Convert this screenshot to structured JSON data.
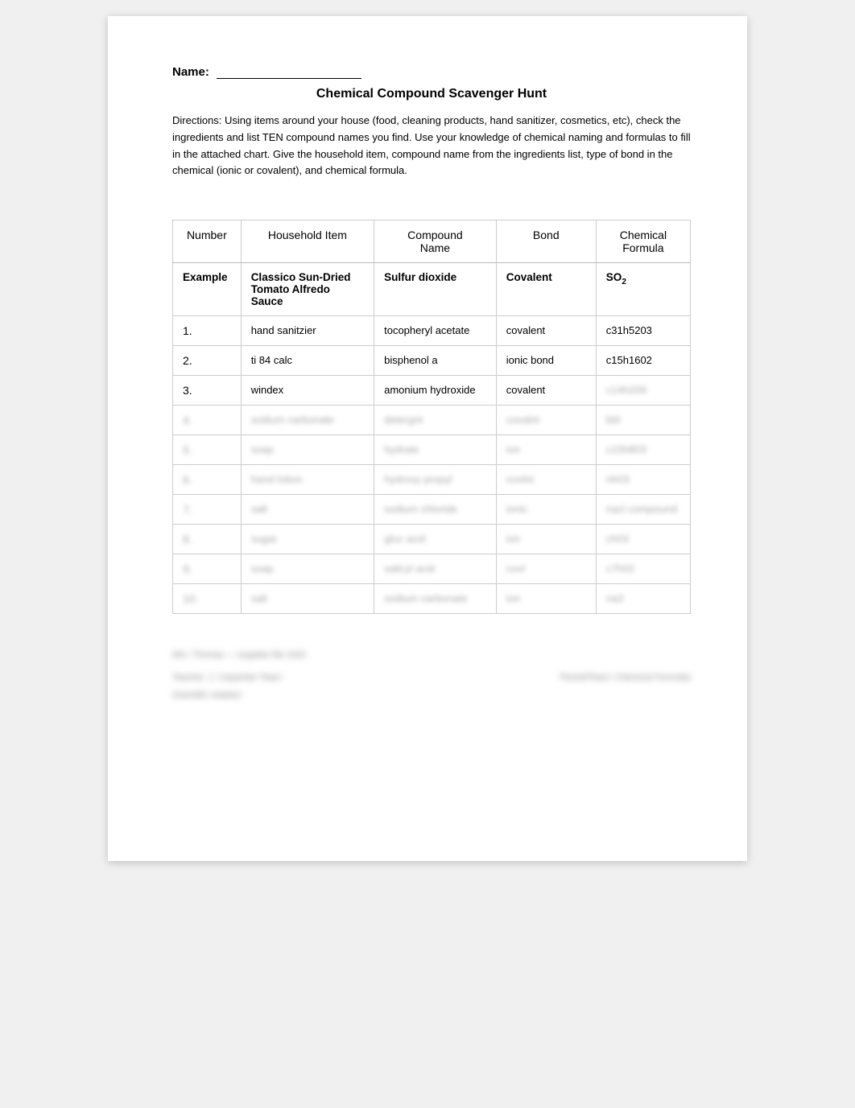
{
  "page": {
    "name_label": "Name:",
    "title": "Chemical Compound Scavenger Hunt",
    "directions": "Directions: Using items around your house (food, cleaning products, hand sanitizer, cosmetics, etc), check the ingredients and list TEN compound names you find. Use your knowledge of chemical naming and formulas to fill in the attached chart. Give the household item, compound name from the ingredients list, type of bond in the chemical (ionic or covalent), and chemical formula.",
    "table": {
      "headers": [
        "Number",
        "Household Item",
        "Compound Name",
        "Bond",
        "Chemical Formula"
      ],
      "example_label": "Example",
      "example": {
        "household": "Classico Sun-Dried Tomato Alfredo Sauce",
        "compound": "Sulfur dioxide",
        "bond": "Covalent",
        "formula_text": "SO",
        "formula_sub": "2"
      },
      "rows": [
        {
          "num": "1.",
          "household": "hand sanitzier",
          "compound": "tocopheryl acetate",
          "bond": "covalent",
          "formula": "c31h5203",
          "blurred": false
        },
        {
          "num": "2.",
          "household": "ti 84  calc",
          "compound": "bisphenol a",
          "bond": "ionic bond",
          "formula": "c15h1602",
          "blurred": false
        },
        {
          "num": "3.",
          "household": "windex",
          "compound": "amonium hydroxide",
          "bond": "covalent",
          "formula": "",
          "blurred": false
        },
        {
          "num": "4.",
          "household": "sodium carbonate",
          "compound": "detergnt",
          "bond": "covalnt",
          "formula": "bld",
          "blurred": true
        },
        {
          "num": "5.",
          "household": "soap",
          "compound": "hydrate",
          "bond": "ion",
          "formula": "c15h803",
          "blurred": true
        },
        {
          "num": "6.",
          "household": "hand lotion",
          "compound": "hydroxy propyl",
          "bond": "covlnt",
          "formula": "nh03",
          "blurred": true
        },
        {
          "num": "7.",
          "household": "salt",
          "compound": "sodium chloride",
          "bond": "ionic",
          "formula": "nacl compound",
          "blurred": true
        },
        {
          "num": "8.",
          "household": "sugar",
          "compound": "gluc acid",
          "bond": "ion",
          "formula": "ch03",
          "blurred": true
        },
        {
          "num": "9.",
          "household": "soap",
          "compound": "salicyl acid",
          "bond": "covl",
          "formula": "c7h02",
          "blurred": true
        },
        {
          "num": "10.",
          "household": "salt",
          "compound": "sodium carbonate",
          "bond": "ion",
          "formula": "na3",
          "blurred": true
        }
      ]
    },
    "footer": {
      "line1": "Mrs. Thomas — supplies file 1020",
      "teacher_label": "Teacher:",
      "teacher_value": "J. Carpenter Team",
      "period_label": "Period/Team:",
      "period_value": "Chemical Formulas",
      "sub_label": "Scientific notation"
    }
  }
}
